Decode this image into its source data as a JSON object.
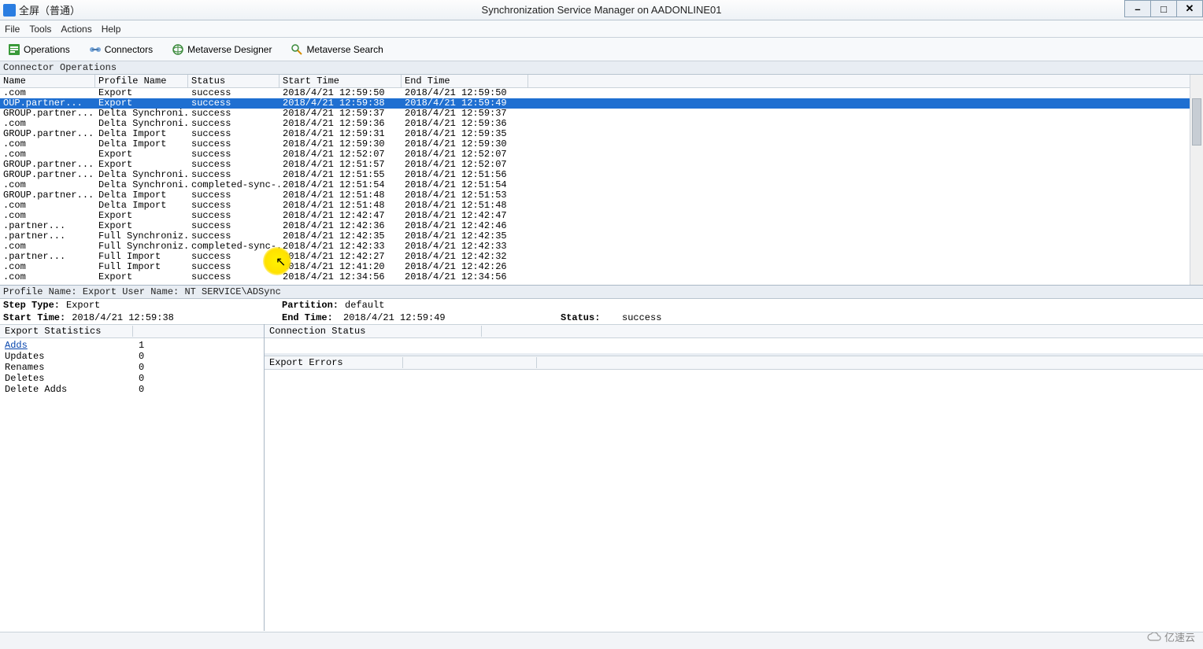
{
  "titlebar": {
    "app_label": "全屏（普通）",
    "window_title": "Synchronization Service Manager on AADONLINE01",
    "minimize_glyph": "–",
    "maximize_glyph": "□",
    "close_glyph": "✕"
  },
  "menubar": [
    "File",
    "Tools",
    "Actions",
    "Help"
  ],
  "toolbar": {
    "operations": "Operations",
    "connectors": "Connectors",
    "mvdesigner": "Metaverse Designer",
    "mvsearch": "Metaverse Search"
  },
  "section_header": "Connector Operations",
  "columns": [
    "Name",
    "Profile Name",
    "Status",
    "Start Time",
    "End Time"
  ],
  "rows": [
    {
      "name": ".com",
      "profile": "Export",
      "status": "success",
      "start": "2018/4/21 12:59:50",
      "end": "2018/4/21 12:59:50",
      "selected": false
    },
    {
      "name": "OUP.partner...",
      "profile": "Export",
      "status": "success",
      "start": "2018/4/21 12:59:38",
      "end": "2018/4/21 12:59:49",
      "selected": true
    },
    {
      "name": "GROUP.partner...",
      "profile": "Delta Synchroni...",
      "status": "success",
      "start": "2018/4/21 12:59:37",
      "end": "2018/4/21 12:59:37",
      "selected": false
    },
    {
      "name": ".com",
      "profile": "Delta Synchroni...",
      "status": "success",
      "start": "2018/4/21 12:59:36",
      "end": "2018/4/21 12:59:36",
      "selected": false
    },
    {
      "name": "GROUP.partner...",
      "profile": "Delta Import",
      "status": "success",
      "start": "2018/4/21 12:59:31",
      "end": "2018/4/21 12:59:35",
      "selected": false
    },
    {
      "name": ".com",
      "profile": "Delta Import",
      "status": "success",
      "start": "2018/4/21 12:59:30",
      "end": "2018/4/21 12:59:30",
      "selected": false
    },
    {
      "name": ".com",
      "profile": "Export",
      "status": "success",
      "start": "2018/4/21 12:52:07",
      "end": "2018/4/21 12:52:07",
      "selected": false
    },
    {
      "name": "GROUP.partner...",
      "profile": "Export",
      "status": "success",
      "start": "2018/4/21 12:51:57",
      "end": "2018/4/21 12:52:07",
      "selected": false
    },
    {
      "name": "GROUP.partner...",
      "profile": "Delta Synchroni...",
      "status": "success",
      "start": "2018/4/21 12:51:55",
      "end": "2018/4/21 12:51:56",
      "selected": false
    },
    {
      "name": ".com",
      "profile": "Delta Synchroni...",
      "status": "completed-sync-...",
      "start": "2018/4/21 12:51:54",
      "end": "2018/4/21 12:51:54",
      "selected": false
    },
    {
      "name": "GROUP.partner...",
      "profile": "Delta Import",
      "status": "success",
      "start": "2018/4/21 12:51:48",
      "end": "2018/4/21 12:51:53",
      "selected": false
    },
    {
      "name": ".com",
      "profile": "Delta Import",
      "status": "success",
      "start": "2018/4/21 12:51:48",
      "end": "2018/4/21 12:51:48",
      "selected": false
    },
    {
      "name": ".com",
      "profile": "Export",
      "status": "success",
      "start": "2018/4/21 12:42:47",
      "end": "2018/4/21 12:42:47",
      "selected": false
    },
    {
      "name": ".partner...",
      "profile": "Export",
      "status": "success",
      "start": "2018/4/21 12:42:36",
      "end": "2018/4/21 12:42:46",
      "selected": false
    },
    {
      "name": ".partner...",
      "profile": "Full Synchroniz...",
      "status": "success",
      "start": "2018/4/21 12:42:35",
      "end": "2018/4/21 12:42:35",
      "selected": false
    },
    {
      "name": ".com",
      "profile": "Full Synchroniz...",
      "status": "completed-sync-...",
      "start": "2018/4/21 12:42:33",
      "end": "2018/4/21 12:42:33",
      "selected": false
    },
    {
      "name": ".partner...",
      "profile": "Full Import",
      "status": "success",
      "start": "2018/4/21 12:42:27",
      "end": "2018/4/21 12:42:32",
      "selected": false
    },
    {
      "name": ".com",
      "profile": "Full Import",
      "status": "success",
      "start": "2018/4/21 12:41:20",
      "end": "2018/4/21 12:42:26",
      "selected": false
    },
    {
      "name": ".com",
      "profile": "Export",
      "status": "success",
      "start": "2018/4/21 12:34:56",
      "end": "2018/4/21 12:34:56",
      "selected": false
    }
  ],
  "detail": {
    "profile_line": "Profile Name: Export   User Name: NT SERVICE\\ADSync",
    "step_type_label": "Step Type:",
    "step_type_value": "Export",
    "partition_label": "Partition:",
    "partition_value": "default",
    "start_time_label": "Start Time:",
    "start_time_value": "2018/4/21 12:59:38",
    "end_time_label": "End Time:",
    "end_time_value": "2018/4/21 12:59:49",
    "status_label": "Status:",
    "status_value": "success"
  },
  "stats_header": "Export Statistics",
  "stats": [
    {
      "name": "Adds",
      "value": "1",
      "link": true
    },
    {
      "name": "Updates",
      "value": "0",
      "link": false
    },
    {
      "name": "Renames",
      "value": "0",
      "link": false
    },
    {
      "name": "Deletes",
      "value": "0",
      "link": false
    },
    {
      "name": "Delete Adds",
      "value": "0",
      "link": false
    }
  ],
  "right_panel": {
    "connection_status": "Connection Status",
    "export_errors": "Export Errors"
  },
  "watermark": "亿速云"
}
